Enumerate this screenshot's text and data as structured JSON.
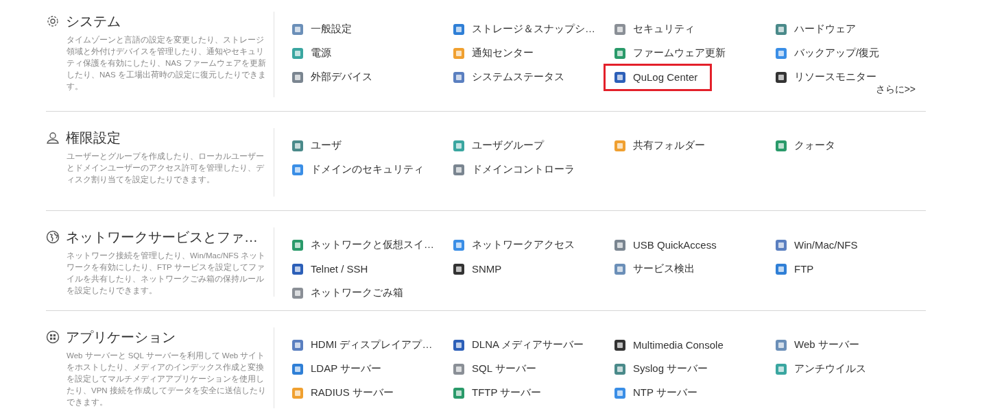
{
  "sections": [
    {
      "title": "システム",
      "description": "タイムゾーンと言語の設定を変更したり、ストレージ領域と外付けデバイスを管理したり、通知やセキュリティ保護を有効にしたり、NAS ファームウェアを更新したり、NAS を工場出荷時の設定に復元したりできます。",
      "items": [
        {
          "label": "一般設定",
          "highlighted": false
        },
        {
          "label": "ストレージ＆スナップシ…",
          "highlighted": false
        },
        {
          "label": "セキュリティ",
          "highlighted": false
        },
        {
          "label": "ハードウェア",
          "highlighted": false
        },
        {
          "label": "電源",
          "highlighted": false
        },
        {
          "label": "通知センター",
          "highlighted": false
        },
        {
          "label": "ファームウェア更新",
          "highlighted": false
        },
        {
          "label": "バックアップ/復元",
          "highlighted": false
        },
        {
          "label": "外部デバイス",
          "highlighted": false
        },
        {
          "label": "システムステータス",
          "highlighted": false
        },
        {
          "label": "QuLog Center",
          "highlighted": true
        },
        {
          "label": "リソースモニター",
          "highlighted": false
        }
      ],
      "more_link": "さらに>>"
    },
    {
      "title": "権限設定",
      "description": "ユーザーとグループを作成したり、ローカルユーザーとドメインユーザーのアクセス許可を管理したり、ディスク割り当てを設定したりできます。",
      "items": [
        {
          "label": "ユーザ",
          "highlighted": false
        },
        {
          "label": "ユーザグループ",
          "highlighted": false
        },
        {
          "label": "共有フォルダー",
          "highlighted": false
        },
        {
          "label": "クォータ",
          "highlighted": false
        },
        {
          "label": "ドメインのセキュリティ",
          "highlighted": false
        },
        {
          "label": "ドメインコントローラ",
          "highlighted": false
        }
      ]
    },
    {
      "title": "ネットワークサービスとファ…",
      "description": "ネットワーク接続を管理したり、Win/Mac/NFS ネットワークを有効にしたり、FTP サービスを設定してファイルを共有したり、ネットワークごみ箱の保持ルールを設定したりできます。",
      "items": [
        {
          "label": "ネットワークと仮想スイ…",
          "highlighted": false
        },
        {
          "label": "ネットワークアクセス",
          "highlighted": false
        },
        {
          "label": "USB QuickAccess",
          "highlighted": false
        },
        {
          "label": "Win/Mac/NFS",
          "highlighted": false
        },
        {
          "label": "Telnet / SSH",
          "highlighted": false
        },
        {
          "label": "SNMP",
          "highlighted": false
        },
        {
          "label": "サービス検出",
          "highlighted": false
        },
        {
          "label": "FTP",
          "highlighted": false
        },
        {
          "label": "ネットワークごみ箱",
          "highlighted": false
        }
      ]
    },
    {
      "title": "アプリケーション",
      "description": "Web サーバーと SQL サーバーを利用して Web サイトをホストしたり、メディアのインデックス作成と変換を設定してマルチメディアアプリケーションを使用したり、VPN 接続を作成してデータを安全に送信したりできます。",
      "items": [
        {
          "label": "HDMI ディスプレイアプ…",
          "highlighted": false
        },
        {
          "label": "DLNA メディアサーバー",
          "highlighted": false
        },
        {
          "label": "Multimedia Console",
          "highlighted": false
        },
        {
          "label": "Web サーバー",
          "highlighted": false
        },
        {
          "label": "LDAP サーバー",
          "highlighted": false
        },
        {
          "label": "SQL サーバー",
          "highlighted": false
        },
        {
          "label": "Syslog サーバー",
          "highlighted": false
        },
        {
          "label": "アンチウイルス",
          "highlighted": false
        },
        {
          "label": "RADIUS サーバー",
          "highlighted": false
        },
        {
          "label": "TFTP サーバー",
          "highlighted": false
        },
        {
          "label": "NTP サーバー",
          "highlighted": false
        }
      ]
    }
  ]
}
